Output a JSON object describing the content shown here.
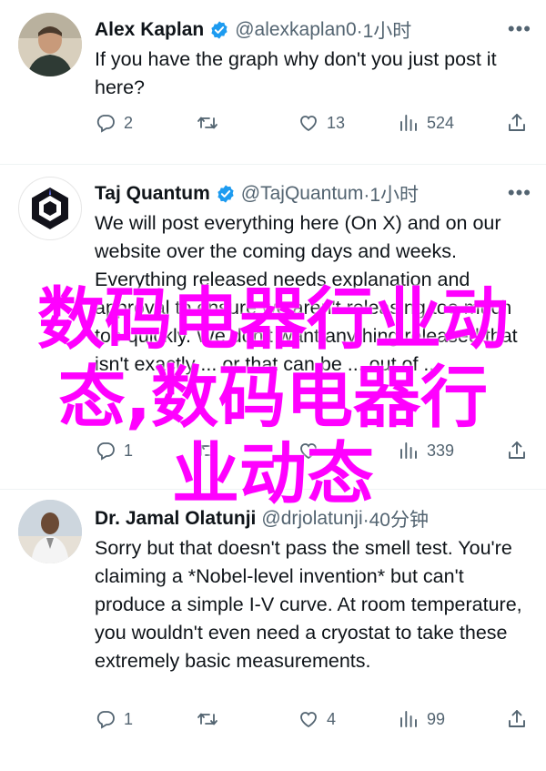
{
  "colors": {
    "verified": "#1d9bf0",
    "overlay": "#ff00ff",
    "secondary": "#536471"
  },
  "tweets": [
    {
      "name": "Alex Kaplan",
      "handle": "@alexkaplan0",
      "time": "·1小时",
      "text": "If you have the graph why don't you just post it here?",
      "replies": "2",
      "retweets": "",
      "likes": "13",
      "views": "524"
    },
    {
      "name": "Taj Quantum",
      "handle": "@TajQuantum",
      "time": "·1小时",
      "text": "We will post everything here (On X) and on our website over the coming days and weeks. Everything released needs explanation and approval to ensure we aren't releasing too much too quickly. We don't want anything released that isn't exactly ... or that can be ... out of ...",
      "replies": "1",
      "retweets": "",
      "likes": "",
      "views": "339"
    },
    {
      "name": "Dr. Jamal Olatunji",
      "handle": "@drjolatunji",
      "time": "·40分钟",
      "text": "Sorry but that doesn't pass the smell test. You're claiming a *Nobel-level invention* but can't produce a simple I-V curve. At room temperature, you wouldn't even need a cryostat to take these extremely basic measurements.",
      "replies": "1",
      "retweets": "",
      "likes": "4",
      "views": "99"
    }
  ],
  "overlay": {
    "line1": "数码电器行业动",
    "line2": "态,数码电器行",
    "line3": "业动态"
  },
  "icons": {
    "reply": "reply-icon",
    "retweet": "retweet-icon",
    "like": "like-icon",
    "views": "views-icon",
    "share": "share-icon",
    "more": "more-icon",
    "verified": "verified-badge-icon"
  }
}
